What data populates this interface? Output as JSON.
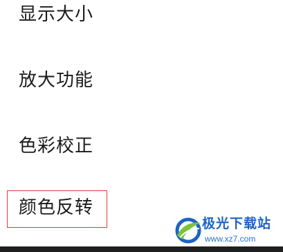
{
  "settings_list": {
    "items": [
      {
        "label": "显示大小"
      },
      {
        "label": "放大功能"
      },
      {
        "label": "色彩校正"
      },
      {
        "label": "颜色反转"
      }
    ],
    "highlighted_item": "颜色反转",
    "highlight_color": "#e0353b"
  },
  "watermark": {
    "title": "极光下载站",
    "url": "www.xz7.com",
    "brand_color": "#1c63c6",
    "accent_color": "#7cc23b",
    "icon": "aurora-logo-icon"
  }
}
